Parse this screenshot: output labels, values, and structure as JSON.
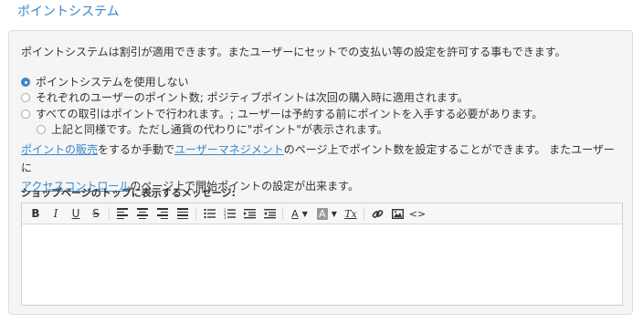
{
  "section_title": "ポイントシステム",
  "description": "ポイントシステムは割引が適用できます。またユーザーにセットでの支払い等の設定を許可する事もできます。",
  "options": [
    {
      "label": "ポイントシステムを使用しない",
      "checked": true
    },
    {
      "label": "それぞれのユーザーのポイント数; ポジティブポイントは次回の購入時に適用されます。",
      "checked": false
    },
    {
      "label": "すべての取引はポイントで行われます。; ユーザーは予約する前にポイントを入手する必要があります。",
      "checked": false
    },
    {
      "label": "上記と同様です。ただし通貨の代わりに\"ポイント\"が表示されます。",
      "checked": false
    }
  ],
  "info": {
    "link1": "ポイントの販売",
    "text1": "をするか手動で",
    "link2": "ユーザーマネジメント",
    "text2": "のページ上でポイント数を設定することができます。 またユーザーに",
    "link3": "アクセスコントロール",
    "text3": "のページ上で開始ポイントの設定が出来ます。"
  },
  "message_label": "ショップページのトップに表示するメッセージ:",
  "toolbar": {
    "bold": "B",
    "italic": "I",
    "underline": "U",
    "strike": "S",
    "font_color": "A",
    "bg_color": "A",
    "clear_format": "Tx",
    "code": "<>"
  }
}
